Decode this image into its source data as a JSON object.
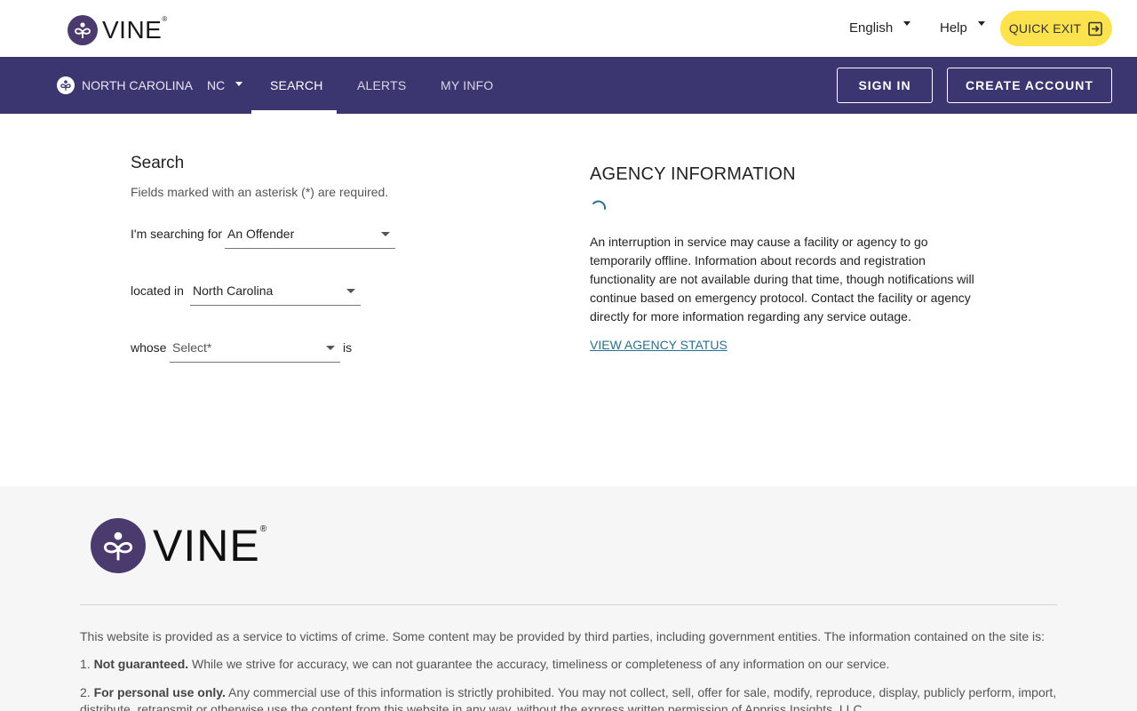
{
  "header": {
    "logo_text": "VINE",
    "logo_reg": "®",
    "language": "English",
    "help": "Help",
    "quick_exit": "QUICK EXIT"
  },
  "nav": {
    "state_name": "NORTH CAROLINA",
    "state_code": "NC",
    "items": [
      {
        "label": "SEARCH",
        "active": true
      },
      {
        "label": "ALERTS",
        "active": false
      },
      {
        "label": "MY INFO",
        "active": false
      }
    ],
    "sign_in": "SIGN IN",
    "create_account": "CREATE ACCOUNT"
  },
  "search": {
    "title": "Search",
    "hint": "Fields marked with an asterisk (*) are required.",
    "searching_for_label": "I'm searching for",
    "searching_for_value": "An Offender",
    "located_in_label": "located in",
    "located_in_value": "North Carolina",
    "whose_label": "whose",
    "whose_placeholder": "Select*",
    "is_label": "is"
  },
  "agency": {
    "title": "AGENCY INFORMATION",
    "text": "An interruption in service may cause a facility or agency to go temporarily offline. Information about records and registration functionality are not available during that time, though notifications will continue based on emergency protocol. Contact the facility or agency directly for more information regarding any service outage.",
    "link": "VIEW AGENCY STATUS"
  },
  "footer": {
    "logo_text": "VINE",
    "logo_reg": "®",
    "intro": "This website is provided as a service to victims of crime. Some content may be provided by third parties, including government entities. The information contained on the site is:",
    "item1_num": "1.",
    "item1_bold": "Not guaranteed.",
    "item1_text": " While we strive for accuracy, we can not guarantee the accuracy, timeliness or completeness of any information on our service.",
    "item2_num": "2.",
    "item2_bold": "For personal use only.",
    "item2_text": " Any commercial use of this information is strictly prohibited. You may not collect, sell, offer for sale, modify, reproduce, display, publicly perform, import, distribute, retransmit or otherwise use the content from this website in any way, without the express written permission of Appriss Insights, LLC."
  },
  "colors": {
    "nav_bg": "#3b3670",
    "logo_purple": "#4a3a6e",
    "quick_exit_bg": "#fce34d",
    "link": "#2a6f8e",
    "footer_bg": "#f6f6f6"
  },
  "icons": {
    "logo": "vine-flower-icon",
    "quick_exit": "exit-door-icon",
    "state": "vine-flower-icon",
    "loading": "spinner-icon"
  }
}
